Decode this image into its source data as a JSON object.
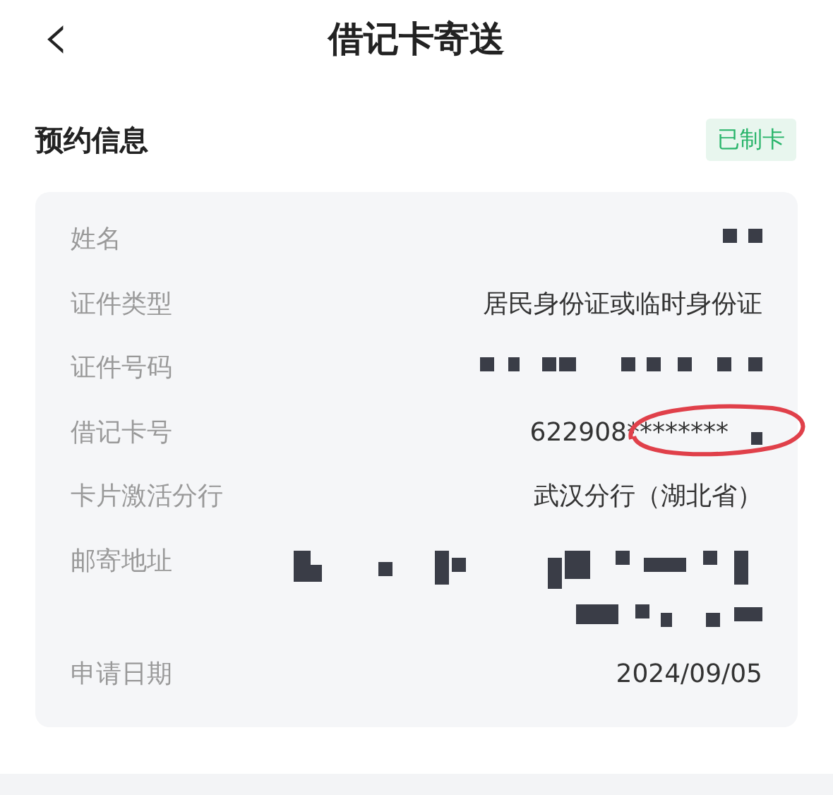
{
  "header": {
    "back": "‹",
    "title": "借记卡寄送"
  },
  "section": {
    "title": "预约信息",
    "badge": "已制卡"
  },
  "rows": [
    {
      "label": "姓名",
      "kind": "redacted"
    },
    {
      "label": "证件类型",
      "kind": "text",
      "value": "居民身份证或临时身份证"
    },
    {
      "label": "证件号码",
      "kind": "redacted"
    },
    {
      "label": "借记卡号",
      "kind": "partial",
      "value": "622908********",
      "circled": true
    },
    {
      "label": "卡片激活分行",
      "kind": "text",
      "value": "武汉分行（湖北省）"
    },
    {
      "label": "邮寄地址",
      "kind": "redacted"
    },
    {
      "label": "申请日期",
      "kind": "text",
      "value": "2024/09/05"
    }
  ]
}
